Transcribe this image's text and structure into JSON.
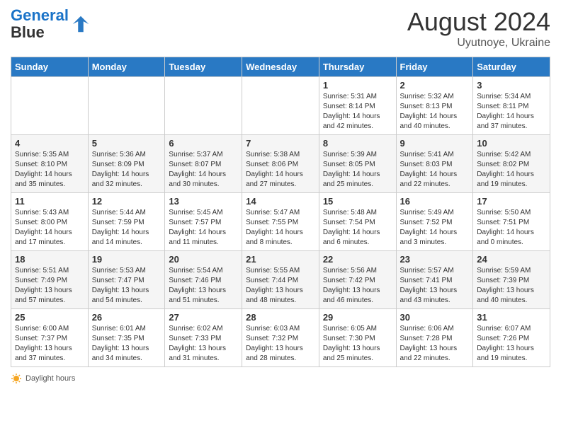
{
  "header": {
    "logo_line1": "General",
    "logo_line2": "Blue",
    "month_year": "August 2024",
    "location": "Uyutnoye, Ukraine"
  },
  "weekdays": [
    "Sunday",
    "Monday",
    "Tuesday",
    "Wednesday",
    "Thursday",
    "Friday",
    "Saturday"
  ],
  "footer": {
    "daylight_label": "Daylight hours"
  },
  "weeks": [
    [
      {
        "day": "",
        "sunrise": "",
        "sunset": "",
        "daylight": ""
      },
      {
        "day": "",
        "sunrise": "",
        "sunset": "",
        "daylight": ""
      },
      {
        "day": "",
        "sunrise": "",
        "sunset": "",
        "daylight": ""
      },
      {
        "day": "",
        "sunrise": "",
        "sunset": "",
        "daylight": ""
      },
      {
        "day": "1",
        "sunrise": "Sunrise: 5:31 AM",
        "sunset": "Sunset: 8:14 PM",
        "daylight": "Daylight: 14 hours and 42 minutes."
      },
      {
        "day": "2",
        "sunrise": "Sunrise: 5:32 AM",
        "sunset": "Sunset: 8:13 PM",
        "daylight": "Daylight: 14 hours and 40 minutes."
      },
      {
        "day": "3",
        "sunrise": "Sunrise: 5:34 AM",
        "sunset": "Sunset: 8:11 PM",
        "daylight": "Daylight: 14 hours and 37 minutes."
      }
    ],
    [
      {
        "day": "4",
        "sunrise": "Sunrise: 5:35 AM",
        "sunset": "Sunset: 8:10 PM",
        "daylight": "Daylight: 14 hours and 35 minutes."
      },
      {
        "day": "5",
        "sunrise": "Sunrise: 5:36 AM",
        "sunset": "Sunset: 8:09 PM",
        "daylight": "Daylight: 14 hours and 32 minutes."
      },
      {
        "day": "6",
        "sunrise": "Sunrise: 5:37 AM",
        "sunset": "Sunset: 8:07 PM",
        "daylight": "Daylight: 14 hours and 30 minutes."
      },
      {
        "day": "7",
        "sunrise": "Sunrise: 5:38 AM",
        "sunset": "Sunset: 8:06 PM",
        "daylight": "Daylight: 14 hours and 27 minutes."
      },
      {
        "day": "8",
        "sunrise": "Sunrise: 5:39 AM",
        "sunset": "Sunset: 8:05 PM",
        "daylight": "Daylight: 14 hours and 25 minutes."
      },
      {
        "day": "9",
        "sunrise": "Sunrise: 5:41 AM",
        "sunset": "Sunset: 8:03 PM",
        "daylight": "Daylight: 14 hours and 22 minutes."
      },
      {
        "day": "10",
        "sunrise": "Sunrise: 5:42 AM",
        "sunset": "Sunset: 8:02 PM",
        "daylight": "Daylight: 14 hours and 19 minutes."
      }
    ],
    [
      {
        "day": "11",
        "sunrise": "Sunrise: 5:43 AM",
        "sunset": "Sunset: 8:00 PM",
        "daylight": "Daylight: 14 hours and 17 minutes."
      },
      {
        "day": "12",
        "sunrise": "Sunrise: 5:44 AM",
        "sunset": "Sunset: 7:59 PM",
        "daylight": "Daylight: 14 hours and 14 minutes."
      },
      {
        "day": "13",
        "sunrise": "Sunrise: 5:45 AM",
        "sunset": "Sunset: 7:57 PM",
        "daylight": "Daylight: 14 hours and 11 minutes."
      },
      {
        "day": "14",
        "sunrise": "Sunrise: 5:47 AM",
        "sunset": "Sunset: 7:55 PM",
        "daylight": "Daylight: 14 hours and 8 minutes."
      },
      {
        "day": "15",
        "sunrise": "Sunrise: 5:48 AM",
        "sunset": "Sunset: 7:54 PM",
        "daylight": "Daylight: 14 hours and 6 minutes."
      },
      {
        "day": "16",
        "sunrise": "Sunrise: 5:49 AM",
        "sunset": "Sunset: 7:52 PM",
        "daylight": "Daylight: 14 hours and 3 minutes."
      },
      {
        "day": "17",
        "sunrise": "Sunrise: 5:50 AM",
        "sunset": "Sunset: 7:51 PM",
        "daylight": "Daylight: 14 hours and 0 minutes."
      }
    ],
    [
      {
        "day": "18",
        "sunrise": "Sunrise: 5:51 AM",
        "sunset": "Sunset: 7:49 PM",
        "daylight": "Daylight: 13 hours and 57 minutes."
      },
      {
        "day": "19",
        "sunrise": "Sunrise: 5:53 AM",
        "sunset": "Sunset: 7:47 PM",
        "daylight": "Daylight: 13 hours and 54 minutes."
      },
      {
        "day": "20",
        "sunrise": "Sunrise: 5:54 AM",
        "sunset": "Sunset: 7:46 PM",
        "daylight": "Daylight: 13 hours and 51 minutes."
      },
      {
        "day": "21",
        "sunrise": "Sunrise: 5:55 AM",
        "sunset": "Sunset: 7:44 PM",
        "daylight": "Daylight: 13 hours and 48 minutes."
      },
      {
        "day": "22",
        "sunrise": "Sunrise: 5:56 AM",
        "sunset": "Sunset: 7:42 PM",
        "daylight": "Daylight: 13 hours and 46 minutes."
      },
      {
        "day": "23",
        "sunrise": "Sunrise: 5:57 AM",
        "sunset": "Sunset: 7:41 PM",
        "daylight": "Daylight: 13 hours and 43 minutes."
      },
      {
        "day": "24",
        "sunrise": "Sunrise: 5:59 AM",
        "sunset": "Sunset: 7:39 PM",
        "daylight": "Daylight: 13 hours and 40 minutes."
      }
    ],
    [
      {
        "day": "25",
        "sunrise": "Sunrise: 6:00 AM",
        "sunset": "Sunset: 7:37 PM",
        "daylight": "Daylight: 13 hours and 37 minutes."
      },
      {
        "day": "26",
        "sunrise": "Sunrise: 6:01 AM",
        "sunset": "Sunset: 7:35 PM",
        "daylight": "Daylight: 13 hours and 34 minutes."
      },
      {
        "day": "27",
        "sunrise": "Sunrise: 6:02 AM",
        "sunset": "Sunset: 7:33 PM",
        "daylight": "Daylight: 13 hours and 31 minutes."
      },
      {
        "day": "28",
        "sunrise": "Sunrise: 6:03 AM",
        "sunset": "Sunset: 7:32 PM",
        "daylight": "Daylight: 13 hours and 28 minutes."
      },
      {
        "day": "29",
        "sunrise": "Sunrise: 6:05 AM",
        "sunset": "Sunset: 7:30 PM",
        "daylight": "Daylight: 13 hours and 25 minutes."
      },
      {
        "day": "30",
        "sunrise": "Sunrise: 6:06 AM",
        "sunset": "Sunset: 7:28 PM",
        "daylight": "Daylight: 13 hours and 22 minutes."
      },
      {
        "day": "31",
        "sunrise": "Sunrise: 6:07 AM",
        "sunset": "Sunset: 7:26 PM",
        "daylight": "Daylight: 13 hours and 19 minutes."
      }
    ]
  ]
}
